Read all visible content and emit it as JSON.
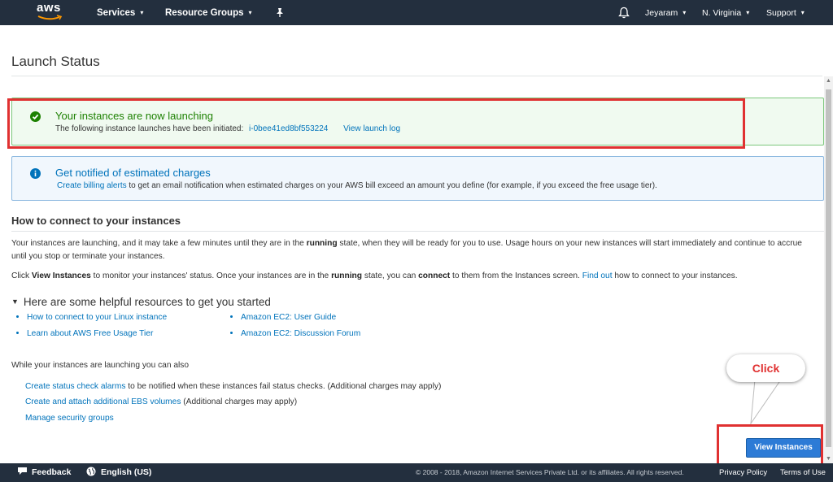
{
  "nav": {
    "logo_text": "aws",
    "services": "Services",
    "resource_groups": "Resource Groups",
    "user": "Jeyaram",
    "region": "N. Virginia",
    "support": "Support"
  },
  "page": {
    "title": "Launch Status"
  },
  "success_alert": {
    "title": "Your instances are now launching",
    "text": "The following instance launches have been initiated:",
    "instance_id": "i-0bee41ed8bf553224",
    "view_log": "View launch log"
  },
  "info_alert": {
    "title": "Get notified of estimated charges",
    "link": "Create billing alerts",
    "text": "to get an email notification when estimated charges on your AWS bill exceed an amount you define (for example, if you exceed the free usage tier)."
  },
  "connect": {
    "heading": "How to connect to your instances",
    "para1_a": "Your instances are launching, and it may take a few minutes until they are in the",
    "para1_bold": "running",
    "para1_b": "state, when they will be ready for you to use. Usage hours on your new instances will start immediately and continue to accrue until you stop or terminate your instances.",
    "para2_a": "Click",
    "para2_bold1": "View Instances",
    "para2_b": "to monitor your instances' status. Once your instances are in the",
    "para2_bold2": "running",
    "para2_c": "state, you can",
    "para2_bold3": "connect",
    "para2_d": "to them from the Instances screen.",
    "para2_link": "Find out",
    "para2_e": "how to connect to your instances."
  },
  "resources": {
    "heading": "Here are some helpful resources to get you started",
    "items": [
      "How to connect to your Linux instance",
      "Learn about AWS Free Usage Tier",
      "Amazon EC2: User Guide",
      "Amazon EC2: Discussion Forum"
    ]
  },
  "also": {
    "heading": "While your instances are launching you can also",
    "items": [
      {
        "link": "Create status check alarms",
        "text": "to be notified when these instances fail status checks. (Additional charges may apply)"
      },
      {
        "link": "Create and attach additional EBS volumes",
        "text": "(Additional charges may apply)"
      },
      {
        "link": "Manage security groups",
        "text": ""
      }
    ]
  },
  "annotation": {
    "callout": "Click"
  },
  "buttons": {
    "view_instances": "View Instances"
  },
  "footer": {
    "feedback": "Feedback",
    "language": "English (US)",
    "copyright": "© 2008 - 2018, Amazon Internet Services Private Ltd. or its affiliates. All rights reserved.",
    "privacy": "Privacy Policy",
    "terms": "Terms of Use"
  },
  "colors": {
    "nav_bg": "#232f3e",
    "success": "#1d8102",
    "info": "#0073bb",
    "highlight": "#e03131",
    "primary_button": "#2d7bd6"
  }
}
